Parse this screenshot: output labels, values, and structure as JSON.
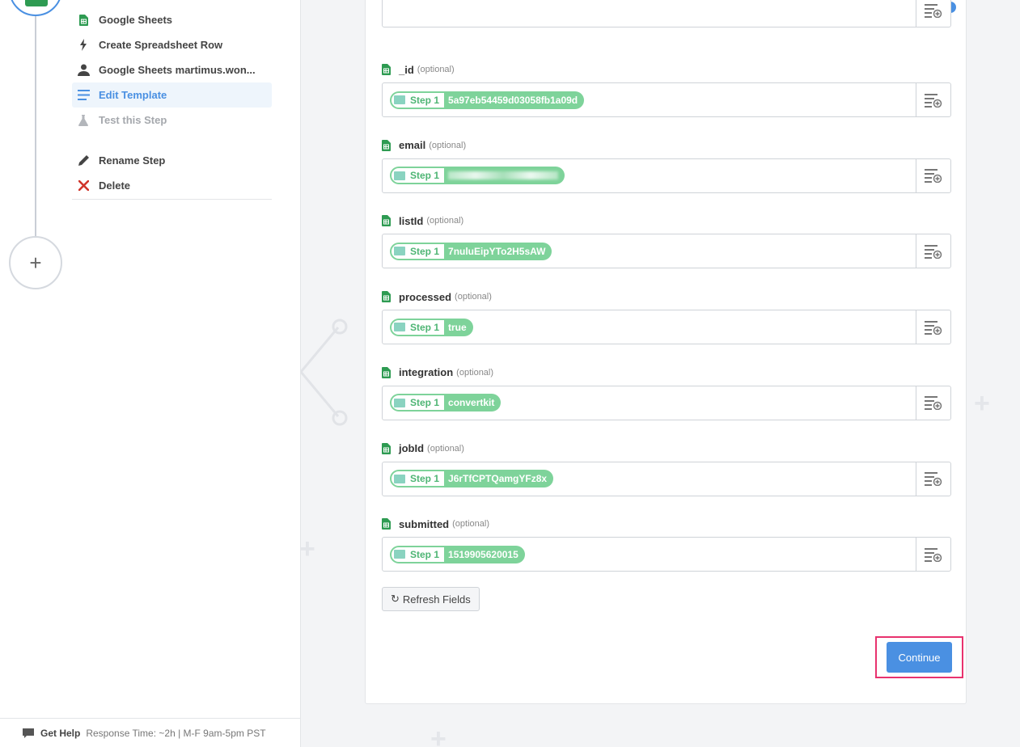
{
  "sidebar": {
    "items": [
      {
        "label": "Google Sheets",
        "icon": "google-sheets-icon"
      },
      {
        "label": "Create Spreadsheet Row",
        "icon": "lightning-icon"
      },
      {
        "label": "Google Sheets martimus.won...",
        "icon": "user-icon"
      },
      {
        "label": "Edit Template",
        "icon": "template-lines-icon",
        "active": true
      },
      {
        "label": "Test this Step",
        "icon": "flask-icon",
        "disabled": true
      }
    ],
    "actions": [
      {
        "label": "Rename Step",
        "icon": "pencil-icon"
      },
      {
        "label": "Delete",
        "icon": "close-icon"
      }
    ],
    "add_step_symbol": "+"
  },
  "help": {
    "label": "Get Help",
    "note": "Response Time: ~2h | M-F 9am-5pm PST"
  },
  "fields": [
    {
      "name": "_id",
      "optional": "(optional)",
      "step": "Step 1",
      "value": "5a97eb54459d03058fb1a09d"
    },
    {
      "name": "email",
      "optional": "(optional)",
      "step": "Step 1",
      "value": "",
      "redacted": true
    },
    {
      "name": "listId",
      "optional": "(optional)",
      "step": "Step 1",
      "value": "7nuluEipYTo2H5sAW"
    },
    {
      "name": "processed",
      "optional": "(optional)",
      "step": "Step 1",
      "value": "true"
    },
    {
      "name": "integration",
      "optional": "(optional)",
      "step": "Step 1",
      "value": "convertkit"
    },
    {
      "name": "jobId",
      "optional": "(optional)",
      "step": "Step 1",
      "value": "J6rTfCPTQamgYFz8x"
    },
    {
      "name": "submitted",
      "optional": "(optional)",
      "step": "Step 1",
      "value": "1519905620015"
    }
  ],
  "buttons": {
    "refresh": "Refresh Fields",
    "continue": "Continue"
  },
  "colors": {
    "accent": "#4a90e2",
    "pill": "#7ed39a",
    "highlight": "#e8326e",
    "sheets_green": "#2e9b52"
  }
}
